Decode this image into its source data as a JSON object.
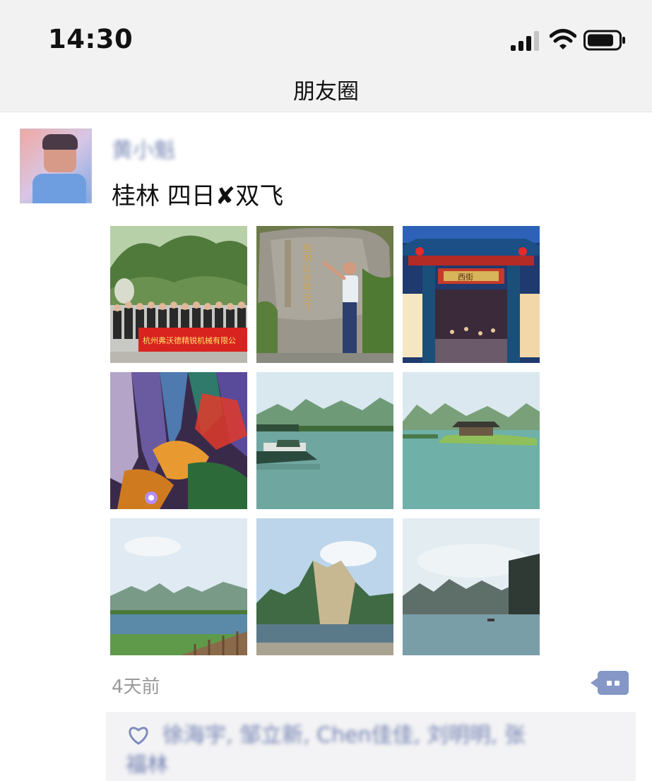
{
  "status_bar": {
    "time": "14:30",
    "signal_icon": "signal-icon",
    "wifi_icon": "wifi-icon",
    "battery_icon": "battery-icon"
  },
  "nav": {
    "title": "朋友圈"
  },
  "post": {
    "author": "黄小魁",
    "text": "桂林  四日✘双飞",
    "photos": [
      {
        "name": "group-photo-banner",
        "banner_text": "杭州弗沃德精锐机械有限公"
      },
      {
        "name": "stone-inscription-photo",
        "inscription": "桂林山水甲天下"
      },
      {
        "name": "night-gate-photo",
        "sign_text": "西街"
      },
      {
        "name": "cave-photo"
      },
      {
        "name": "river-boats-photo"
      },
      {
        "name": "river-pavilion-photo"
      },
      {
        "name": "river-boardwalk-photo"
      },
      {
        "name": "karst-cliff-photo"
      },
      {
        "name": "river-mountains-photo"
      }
    ],
    "timestamp": "4天前",
    "comment_icon": "comment-icon",
    "likes": {
      "icon": "heart-icon",
      "line1": "徐海宇, 邹立新, Chen佳佳, 刘明明, 张",
      "line2": "福林"
    }
  }
}
